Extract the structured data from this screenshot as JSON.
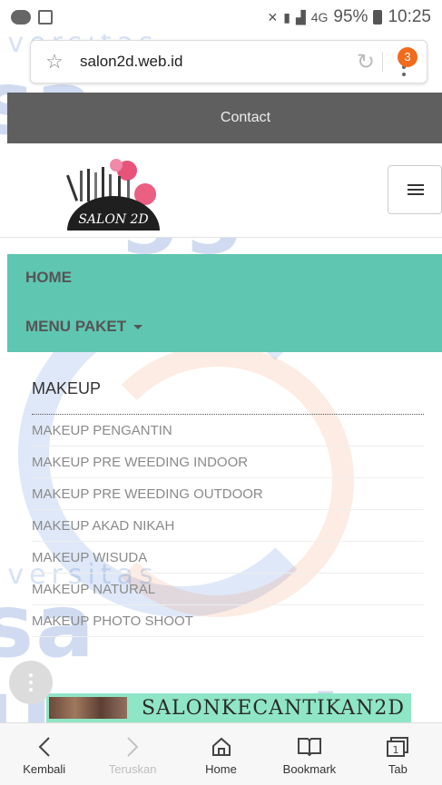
{
  "status_bar": {
    "network": "4G",
    "battery": "95%",
    "time": "10:25",
    "icons": [
      "line-icon",
      "image-icon",
      "mute-icon",
      "sim-icon",
      "signal-icon",
      "battery-icon"
    ]
  },
  "browser": {
    "url": "salon2d.web.id",
    "tab_badge": "3"
  },
  "top_nav": {
    "contact": "Contact"
  },
  "logo": {
    "text": "SALON 2D"
  },
  "nav": {
    "home": "HOME",
    "menu_paket": "MENU PAKET"
  },
  "submenu": {
    "heading": "MAKEUP",
    "items": [
      "MAKEUP PENGANTIN",
      "MAKEUP PRE WEEDING INDOOR",
      "MAKEUP PRE WEEDING OUTDOOR",
      "MAKEUP AKAD NIKAH",
      "MAKEUP WISUDA",
      "MAKEUP NATURAL",
      "MAKEUP PHOTO SHOOT"
    ]
  },
  "banner": {
    "text": "SALONKECANTIKAN2D"
  },
  "bottom_bar": {
    "back": "Kembali",
    "forward": "Teruskan",
    "home": "Home",
    "bookmark": "Bookmark",
    "tabs": "Tab",
    "tab_count": "1"
  },
  "colors": {
    "nav_bg": "#5fc6b1",
    "contact_bg": "#5f5f5f",
    "banner_bg": "#8fe6c6",
    "badge": "#f06c1c"
  }
}
